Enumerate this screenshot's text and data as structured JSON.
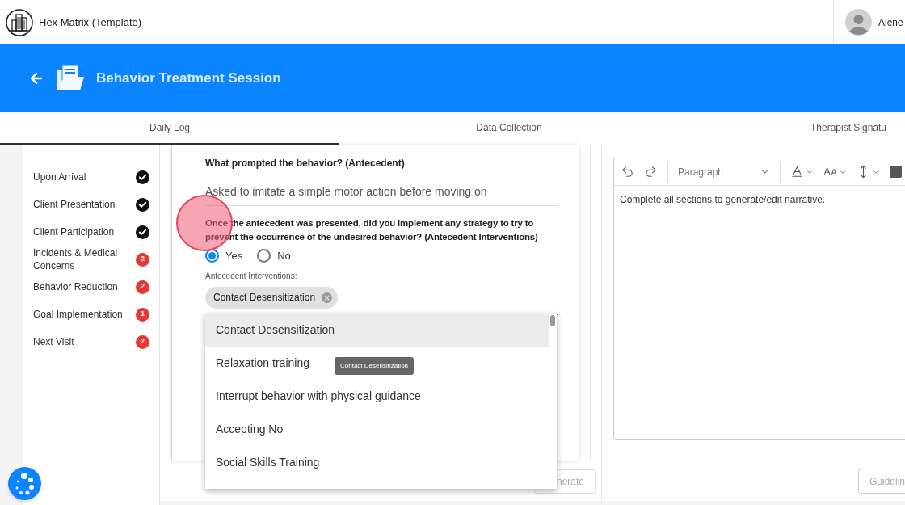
{
  "app": {
    "title": "Hex Matrix (Template)",
    "user_name": "Alene"
  },
  "header": {
    "title": "Behavior Treatment Session"
  },
  "tabs": [
    {
      "label": "Daily Log",
      "selected": true
    },
    {
      "label": "Data Collection",
      "selected": false
    },
    {
      "label": "Therapist Signatu",
      "selected": false
    }
  ],
  "sidebar": {
    "items": [
      {
        "label": "Upon Arrival",
        "kind": "done"
      },
      {
        "label": "Client Presentation",
        "kind": "done"
      },
      {
        "label": "Client Participation",
        "kind": "done"
      },
      {
        "label": "Incidents & Medical Concerns",
        "kind": "count",
        "count": "2"
      },
      {
        "label": "Behavior Reduction",
        "kind": "count",
        "count": "2"
      },
      {
        "label": "Goal Implementation",
        "kind": "count",
        "count": "1"
      },
      {
        "label": "Next Visit",
        "kind": "count",
        "count": "2"
      }
    ]
  },
  "form": {
    "antecedent_label": "What prompted the behavior? (Antecedent)",
    "antecedent_value": "Asked to imitate a simple motor action before moving on",
    "question": "Once the antecedent was presented, did you implement any strategy to try to prevent the occurrence of the undesired behavior? (Antecedent Interventions)",
    "radios": [
      {
        "label": "Yes",
        "selected": true
      },
      {
        "label": "No",
        "selected": false
      }
    ],
    "interventions_label": "Antecedent Interventions:",
    "chips": [
      "Contact Desensitization"
    ],
    "options": [
      {
        "label": "Contact Desensitization",
        "highlighted": true
      },
      {
        "label": "Relaxation training",
        "highlighted": false
      },
      {
        "label": "Interrupt behavior with physical guidance",
        "highlighted": false
      },
      {
        "label": "Accepting No",
        "highlighted": false
      },
      {
        "label": "Social Skills Training",
        "highlighted": false
      }
    ],
    "tooltip": "Contact Desensitization",
    "footer_button": "nerate"
  },
  "editor": {
    "block_style": "Paragraph",
    "text": "Complete all sections to generate/edit narrative.",
    "footer_button": "Guidelin"
  }
}
